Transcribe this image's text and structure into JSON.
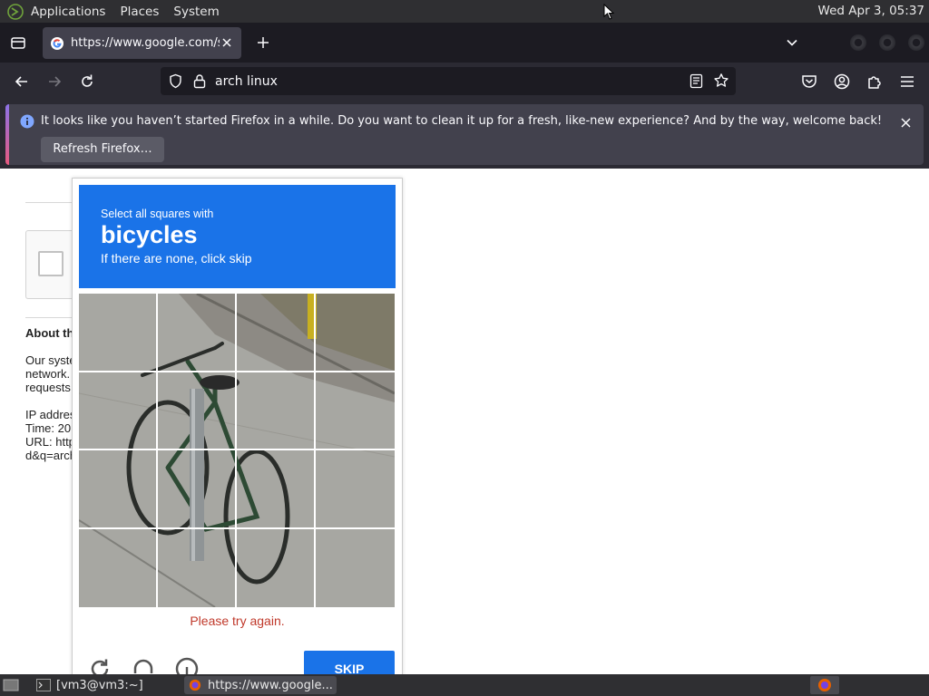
{
  "top_panel": {
    "menus": [
      "Applications",
      "Places",
      "System"
    ],
    "clock": "Wed Apr  3, 05:37"
  },
  "browser": {
    "tab": {
      "title": "https://www.google.com/sorry/index?continue=https://www.google.com/search"
    },
    "url_bar": {
      "value": "arch linux"
    },
    "notification": {
      "message": "It looks like you haven’t started Firefox in a while. Do you want to clean it up for a fresh, like-new experience? And by the way, welcome back!",
      "button_label": "Refresh Firefox…"
    }
  },
  "page": {
    "about_heading": "About th",
    "body_lines": [
      "Our syste",
      "network.",
      "requests",
      "",
      "IP addres",
      "Time: 20",
      "URL: http",
      "d&q=arch"
    ]
  },
  "captcha": {
    "instruction": "Select all squares with",
    "target": "bicycles",
    "hint": "If there are none, click skip",
    "error": "Please try again.",
    "skip_label": "SKIP",
    "rows": 4,
    "cols": 4
  },
  "taskbar": {
    "tasks": [
      "[vm3@vm3:~]",
      "https://www.google..."
    ]
  },
  "colors": {
    "captcha_blue": "#1a73e8",
    "error_red": "#c0392b",
    "firefox_dark": "#1c1b22"
  }
}
